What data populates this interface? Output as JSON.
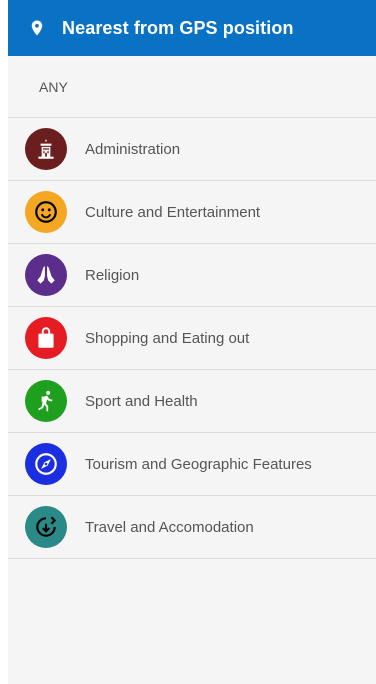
{
  "header": {
    "title": "Nearest from GPS position",
    "icon": "location-pin-icon"
  },
  "list": {
    "any_label": "ANY",
    "items": [
      {
        "label": "Administration",
        "icon": "government-building-icon",
        "color": "#6b1e1e"
      },
      {
        "label": "Culture and Entertainment",
        "icon": "smiley-face-icon",
        "color": "#f5a623"
      },
      {
        "label": "Religion",
        "icon": "praying-hands-icon",
        "color": "#5b2e8c"
      },
      {
        "label": "Shopping and Eating out",
        "icon": "shopping-bag-icon",
        "color": "#e51c23"
      },
      {
        "label": "Sport and Health",
        "icon": "running-person-icon",
        "color": "#1ea01e"
      },
      {
        "label": "Tourism and Geographic Features",
        "icon": "compass-icon",
        "color": "#1b2ee0"
      },
      {
        "label": "Travel and Accomodation",
        "icon": "travel-arrow-icon",
        "color": "#2a8a88"
      }
    ]
  }
}
